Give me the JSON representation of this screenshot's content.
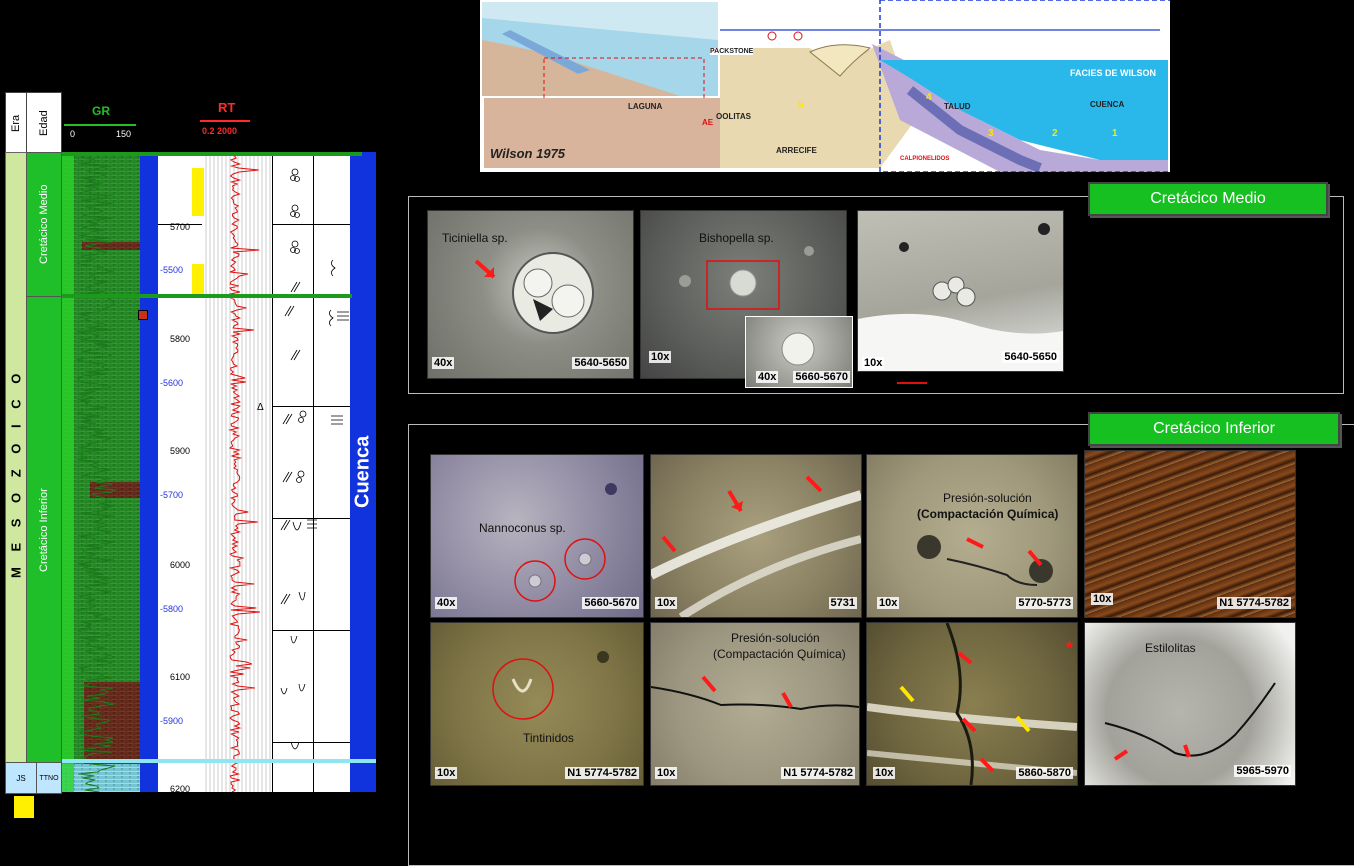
{
  "log": {
    "era_header": "Era",
    "edad_header": "Edad",
    "era_value": "M E S O Z O I C O",
    "edad_medio": "Cretácico Medio",
    "edad_inferior": "Cretácico Inferior",
    "js_label": "JS",
    "ttno_label": "TTNO",
    "gr_label": "GR",
    "gr_min": "0",
    "gr_max": "150",
    "rt_label": "RT",
    "rt_scale": "0.2 2000",
    "depth_md": [
      "5700",
      "5800",
      "5900",
      "6000",
      "6100",
      "6200"
    ],
    "depth_tvd": [
      "-5500",
      "-5600",
      "-5700",
      "-5800",
      "-5900"
    ],
    "environment": "Cuenca"
  },
  "wilson": {
    "caption": "Wilson 1975",
    "facies_title": "FACIES DE WILSON",
    "laguna": "LAGUNA",
    "oolitas": "OOLITAS",
    "arrecife": "ARRECIFE",
    "talud": "TALUD",
    "cuenca": "CUENCA",
    "packstone": "PACKSTONE",
    "calpionelidos": "CALPIONELIDOS",
    "ae": "AE",
    "numbers": [
      "1",
      "2",
      "3",
      "4",
      "5"
    ]
  },
  "medio": {
    "title": "Cretácico Medio",
    "photos": [
      {
        "name": "Ticiniella sp.",
        "mag": "40x",
        "depth": "5640-5650"
      },
      {
        "name": "Bishopella sp.",
        "mag": "10x",
        "depth": ""
      },
      {
        "name": "",
        "mag": "40x",
        "depth": "5660-5670"
      },
      {
        "name": "",
        "mag": "10x",
        "depth": "5640-5650"
      }
    ]
  },
  "inferior": {
    "title": "Cretácico Inferior",
    "photos_row1": [
      {
        "name": "Nannoconus sp.",
        "mag": "40x",
        "depth": "5660-5670"
      },
      {
        "name": "",
        "mag": "10x",
        "depth": "5731"
      },
      {
        "name": "Presión-solución",
        "name2": "(Compactación Química)",
        "mag": "10x",
        "depth": "5770-5773"
      },
      {
        "name": "",
        "mag": "10x",
        "depth": "N1 5774-5782"
      }
    ],
    "photos_row2": [
      {
        "name": "Tintinidos",
        "mag": "10x",
        "depth": "N1 5774-5782"
      },
      {
        "name": "Presión-solución",
        "name2": "(Compactación Química)",
        "mag": "10x",
        "depth": "N1 5774-5782"
      },
      {
        "name": "",
        "mag": "10x",
        "depth": "5860-5870"
      },
      {
        "name": "Estilolitas",
        "mag": "",
        "depth": "5965-5970"
      }
    ]
  },
  "colors": {
    "green_badge": "#15c020",
    "basin_blue": "#1133dd",
    "arrow_red": "#ff1a1a",
    "arrow_yellow": "#ffe600"
  }
}
